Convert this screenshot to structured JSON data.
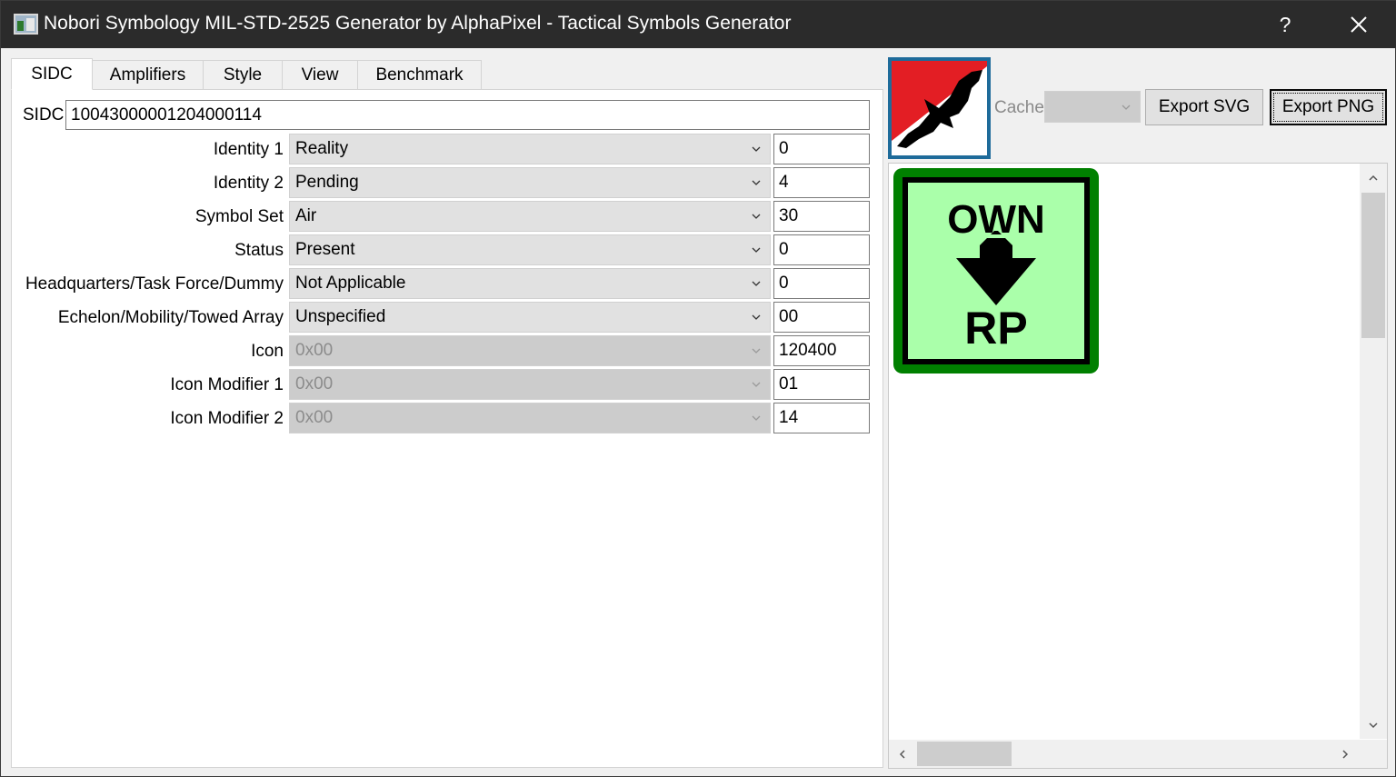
{
  "window": {
    "title": "Nobori Symbology  MIL-STD-2525 Generator by AlphaPixel - Tactical Symbols Generator",
    "help_label": "?",
    "icon": "app-icon",
    "close_icon": "close-icon"
  },
  "tabs": [
    {
      "label": "SIDC",
      "active": true
    },
    {
      "label": "Amplifiers",
      "active": false
    },
    {
      "label": "Style",
      "active": false
    },
    {
      "label": "View",
      "active": false
    },
    {
      "label": "Benchmark",
      "active": false
    }
  ],
  "sidc": {
    "label": "SIDC",
    "value": "10043000001204000114"
  },
  "rows": [
    {
      "label": "Identity 1",
      "selected": "Reality",
      "code": "0",
      "enabled": true
    },
    {
      "label": "Identity 2",
      "selected": "Pending",
      "code": "4",
      "enabled": true
    },
    {
      "label": "Symbol Set",
      "selected": "Air",
      "code": "30",
      "enabled": true
    },
    {
      "label": "Status",
      "selected": "Present",
      "code": "0",
      "enabled": true
    },
    {
      "label": "Headquarters/Task Force/Dummy",
      "selected": "Not Applicable",
      "code": "0",
      "enabled": true
    },
    {
      "label": "Echelon/Mobility/Towed Array",
      "selected": "Unspecified",
      "code": "00",
      "enabled": true
    },
    {
      "label": "Icon",
      "selected": "0x00",
      "code": "120400",
      "enabled": false
    },
    {
      "label": "Icon Modifier 1",
      "selected": "0x00",
      "code": "01",
      "enabled": false
    },
    {
      "label": "Icon Modifier 2",
      "selected": "0x00",
      "code": "14",
      "enabled": false
    }
  ],
  "toolbar": {
    "cache_label": "Cache",
    "cache_value": "",
    "export_svg_label": "Export SVG",
    "export_png_label": "Export PNG"
  },
  "symbol": {
    "top_text": "OWN",
    "bottom_text": "RP",
    "fill_color": "#aaffaa",
    "frame_color": "#008000",
    "icon": "down-arrow-icon"
  },
  "logo": {
    "icon": "eagle-logo-icon",
    "accent": "#e31e24",
    "border": "#1e6b9a"
  }
}
